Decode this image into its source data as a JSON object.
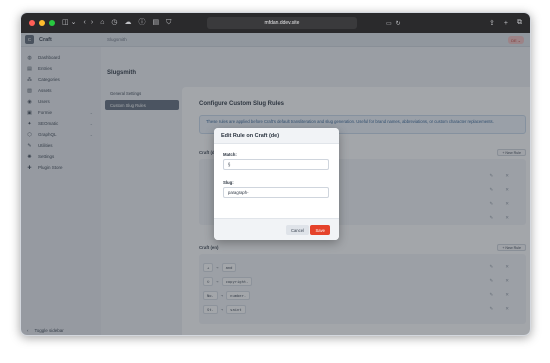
{
  "browser": {
    "url": "mfdan.ddev.site",
    "icons": [
      "sidebar-icon",
      "chevron-left-icon",
      "chevron-right-icon",
      "home-icon",
      "history-icon",
      "cloud-icon",
      "info-icon",
      "reader-icon",
      "shield-icon",
      "share-icon",
      "plus-icon",
      "tabs-icon"
    ]
  },
  "header": {
    "site_name": "Craft",
    "site_initial": "C",
    "breadcrumb": "Slugsmith",
    "badge": "DE"
  },
  "sidebar": {
    "items": [
      {
        "label": "Dashboard",
        "icon": "◍"
      },
      {
        "label": "Entries",
        "icon": "▤"
      },
      {
        "label": "Categories",
        "icon": "⁂"
      },
      {
        "label": "Assets",
        "icon": "▨"
      },
      {
        "label": "Users",
        "icon": "◉"
      },
      {
        "label": "Formie",
        "icon": "▣",
        "chevron": "⌄"
      },
      {
        "label": "SEOmatic",
        "icon": "✦",
        "chevron": "⌄"
      },
      {
        "label": "GraphQL",
        "icon": "⬡",
        "chevron": "⌄"
      },
      {
        "label": "Utilities",
        "icon": "✎"
      },
      {
        "label": "Settings",
        "icon": "✺"
      },
      {
        "label": "Plugin Store",
        "icon": "✚"
      }
    ],
    "toggle_label": "Toggle sidebar"
  },
  "plugin": {
    "title": "Slugsmith",
    "nav": [
      {
        "label": "General Settings",
        "active": false
      },
      {
        "label": "Custom Slug Rules",
        "active": true
      }
    ]
  },
  "main": {
    "title": "Configure Custom Slug Rules",
    "info": "These rules are applied before Craft's default transliteration and slug generation. Useful for brand names, abbreviations, or custom character replacements.",
    "new_rule_label": "+ New Rule",
    "sections": [
      {
        "label": "Craft (de)",
        "rules": []
      },
      {
        "label": "Craft (en)",
        "rules": [
          {
            "match": "+",
            "arrow": "→",
            "slug": "and"
          },
          {
            "match": "©",
            "arrow": "→",
            "slug": "copyright-"
          },
          {
            "match": "No.",
            "arrow": "→",
            "slug": "number-"
          },
          {
            "match": "St.",
            "arrow": "→",
            "slug": "saint"
          }
        ]
      }
    ],
    "action_icons": {
      "edit": "✎",
      "delete": "✕"
    }
  },
  "modal": {
    "title": "Edit Rule on Craft (de)",
    "match_label": "Match:",
    "match_value": "§",
    "slug_label": "Slug:",
    "slug_value": "paragraph-",
    "cancel_label": "Cancel",
    "save_label": "Save"
  }
}
